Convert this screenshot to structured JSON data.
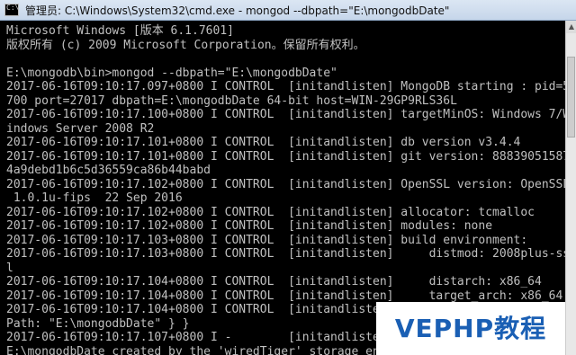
{
  "window": {
    "title": "管理员: C:\\Windows\\System32\\cmd.exe - mongod  --dbpath=\"E:\\mongodbDate\""
  },
  "console": {
    "lines": [
      "Microsoft Windows [版本 6.1.7601]",
      "版权所有 (c) 2009 Microsoft Corporation。保留所有权利。",
      "",
      "E:\\mongodb\\bin>mongod --dbpath=\"E:\\mongodbDate\"",
      "2017-06-16T09:10:17.097+0800 I CONTROL  [initandlisten] MongoDB starting : pid=5",
      "700 port=27017 dbpath=E:\\mongodbDate 64-bit host=WIN-29GP9RLS36L",
      "2017-06-16T09:10:17.100+0800 I CONTROL  [initandlisten] targetMinOS: Windows 7/W",
      "indows Server 2008 R2",
      "2017-06-16T09:10:17.101+0800 I CONTROL  [initandlisten] db version v3.4.4",
      "2017-06-16T09:10:17.101+0800 I CONTROL  [initandlisten] git version: 88839051587",
      "4a9debd1b6c5d36559ca86b44babd",
      "2017-06-16T09:10:17.102+0800 I CONTROL  [initandlisten] OpenSSL version: OpenSSL",
      " 1.0.1u-fips  22 Sep 2016",
      "2017-06-16T09:10:17.102+0800 I CONTROL  [initandlisten] allocator: tcmalloc",
      "2017-06-16T09:10:17.102+0800 I CONTROL  [initandlisten] modules: none",
      "2017-06-16T09:10:17.103+0800 I CONTROL  [initandlisten] build environment:",
      "2017-06-16T09:10:17.103+0800 I CONTROL  [initandlisten]     distmod: 2008plus-ss",
      "l",
      "2017-06-16T09:10:17.104+0800 I CONTROL  [initandlisten]     distarch: x86_64",
      "2017-06-16T09:10:17.104+0800 I CONTROL  [initandlisten]     target_arch: x86_64",
      "2017-06-16T09:10:17.104+0800 I CONTROL  [initandlisten] options: { storage: { db",
      "Path: \"E:\\mongodbDate\" } }",
      "2017-06-16T09:10:17.107+0800 I -        [initandlisten]",
      "E:\\mongodbDate created by the 'wiredTiger' storage engi"
    ]
  },
  "watermark": {
    "text": "VEPHP教程"
  }
}
